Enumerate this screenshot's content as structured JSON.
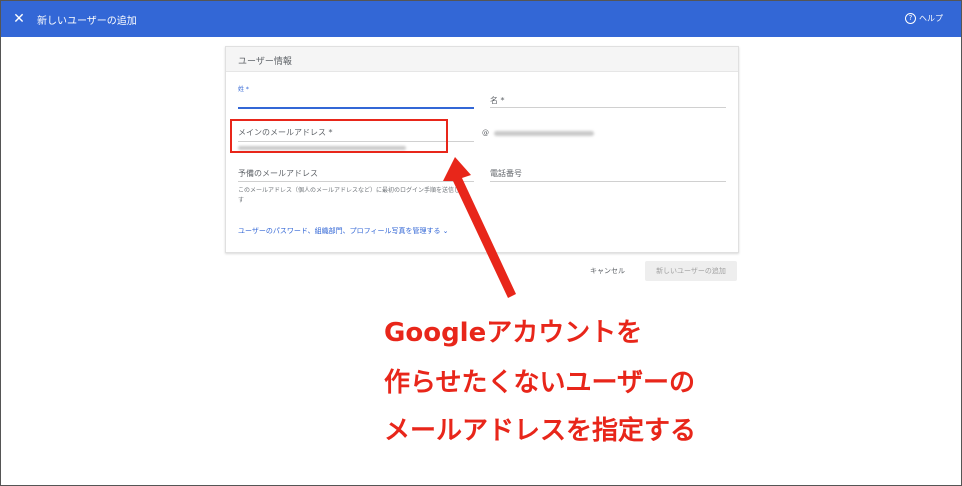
{
  "header": {
    "close_icon": "close-icon",
    "title": "新しいユーザーの追加",
    "help_label": "ヘルプ"
  },
  "form": {
    "section_title": "ユーザー情報",
    "last_name_label": "姓 *",
    "first_name_label": "名 *",
    "main_email_label": "メインのメールアドレス *",
    "at_sign": "@",
    "secondary_email_label": "予備のメールアドレス",
    "secondary_email_helper": "このメールアドレス（個人のメールアドレスなど）に最初のログイン手順を送信します",
    "phone_label": "電話番号",
    "manage_link": "ユーザーのパスワード、組織部門、プロフィール写真を管理する ⌄"
  },
  "actions": {
    "cancel_label": "キャンセル",
    "submit_label": "新しいユーザーの追加"
  },
  "annotation": {
    "lines": [
      "Googleアカウントを",
      "作らせたくないユーザーの",
      "メールアドレスを指定する"
    ],
    "color": "#e8261a"
  },
  "colors": {
    "header_bg": "#3367d6",
    "accent": "#3367d6"
  }
}
